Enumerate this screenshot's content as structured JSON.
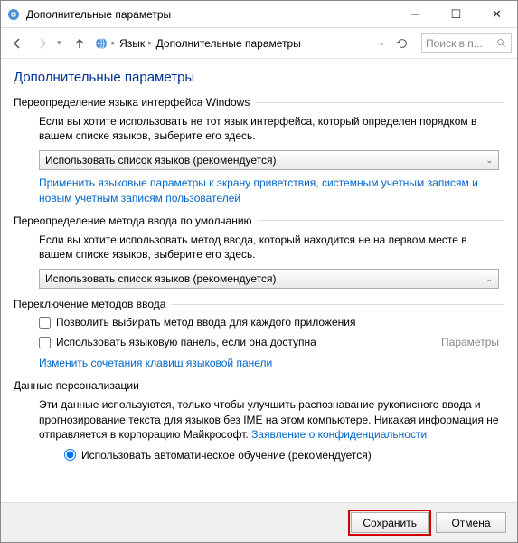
{
  "window": {
    "title": "Дополнительные параметры"
  },
  "nav": {
    "crumb1": "Язык",
    "crumb2": "Дополнительные параметры",
    "search_placeholder": "Поиск в п..."
  },
  "page": {
    "title": "Дополнительные параметры"
  },
  "section1": {
    "header": "Переопределение языка интерфейса Windows",
    "desc": "Если вы хотите использовать не тот язык интерфейса, который определен порядком в вашем списке языков, выберите его здесь.",
    "dropdown": "Использовать список языков (рекомендуется)",
    "link": "Применить языковые параметры к экрану приветствия, системным учетным записям и новым учетным записям пользователей"
  },
  "section2": {
    "header": "Переопределение метода ввода по умолчанию",
    "desc": "Если вы хотите использовать метод ввода, который находится не на первом месте в вашем списке языков, выберите его здесь.",
    "dropdown": "Использовать список языков (рекомендуется)"
  },
  "section3": {
    "header": "Переключение методов ввода",
    "cb1": "Позволить выбирать метод ввода для каждого приложения",
    "cb2": "Использовать языковую панель, если она доступна",
    "params": "Параметры",
    "link": "Изменить сочетания клавиш языковой панели"
  },
  "section4": {
    "header": "Данные персонализации",
    "desc": "Эти данные используются, только чтобы улучшить распознавание рукописного ввода и прогнозирование текста для языков без IME на этом компьютере. Никакая информация не отправляется в корпорацию Майкрософт. ",
    "link": "Заявление о конфиденциальности",
    "radio": "Использовать автоматическое обучение (рекомендуется)"
  },
  "footer": {
    "save": "Сохранить",
    "cancel": "Отмена"
  }
}
